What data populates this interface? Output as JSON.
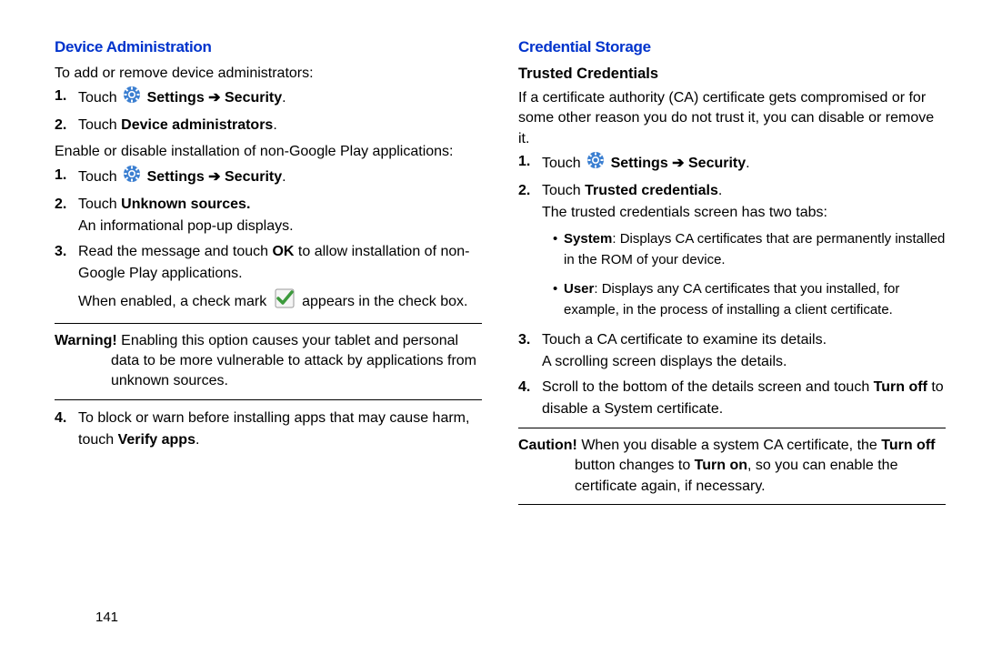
{
  "page_number": "141",
  "arrow": "➔",
  "left": {
    "h1": "Device Administration",
    "intro1": "To add or remove device administrators:",
    "l1_1_pre": "Touch ",
    "l1_1_b1": "Settings ",
    "l1_1_b2": " Security",
    "l1_2_pre": "Touch ",
    "l1_2_b": "Device administrators",
    "intro2": "Enable or disable installation of non-Google Play applications:",
    "l2_1_pre": "Touch ",
    "l2_1_b1": "Settings ",
    "l2_1_b2": " Security",
    "l2_2_pre": "Touch ",
    "l2_2_b": "Unknown sources.",
    "l2_2_tail": "An informational pop-up displays.",
    "l2_3_pre": "Read the message and touch ",
    "l2_3_b": "OK",
    "l2_3_post": " to allow installation of non-Google Play applications.",
    "l2_3_w1": "When enabled, a check mark ",
    "l2_3_w2": " appears in the check box.",
    "warn_lead": "Warning!",
    "warn_text": " Enabling this option causes your tablet and personal data to be more vulnerable to attack by applications from unknown sources.",
    "l2_4_pre": "To block or warn before installing apps that may cause harm, touch ",
    "l2_4_b": "Verify apps",
    "dot": "."
  },
  "right": {
    "h1": "Credential Storage",
    "h2": "Trusted Credentials",
    "intro": "If a certificate authority (CA) certificate gets compromised or for some other reason you do not trust it, you can disable or remove it.",
    "l1_1_pre": "Touch ",
    "l1_1_b1": "Settings ",
    "l1_1_b2": " Security",
    "l1_2_pre": "Touch ",
    "l1_2_b": "Trusted credentials",
    "l1_2_tail": "The trusted credentials screen has two tabs:",
    "bl1_b": "System",
    "bl1_t": ": Displays CA certificates that are permanently installed in the ROM of your device.",
    "bl2_b": "User",
    "bl2_t": ": Displays any CA certificates that you installed, for example, in the process of installing a client certificate.",
    "l1_3a": "Touch a CA certificate to examine its details.",
    "l1_3b": "A scrolling screen displays the details.",
    "l1_4_pre": "Scroll to the bottom of the details screen and touch ",
    "l1_4_b": "Turn off",
    "l1_4_post": " to disable a System certificate.",
    "caut_lead": "Caution!",
    "caut_t1": " When you disable a system CA certificate, the ",
    "caut_b1": "Turn off",
    "caut_t2": " button changes to ",
    "caut_b2": "Turn on",
    "caut_t3": ", so you can enable the certificate again, if necessary.",
    "dot": "."
  }
}
